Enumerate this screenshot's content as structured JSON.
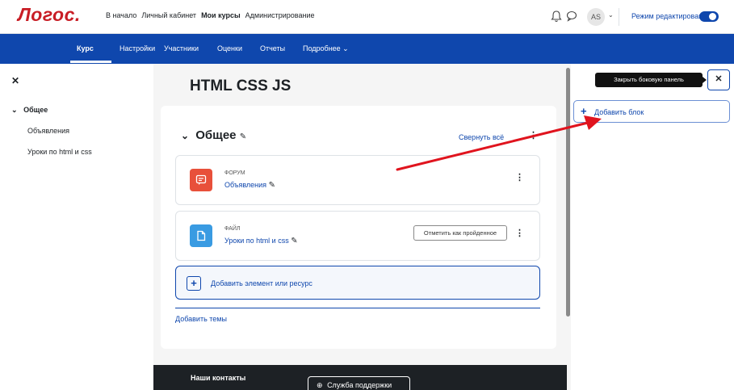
{
  "brand": {
    "logo": "Логос."
  },
  "topnav": {
    "items": [
      "В начало",
      "Личный кабинет",
      "Мои курсы",
      "Администрирование"
    ],
    "avatar_initials": "AS",
    "edit_mode_label": "Режим редактирования"
  },
  "course_nav": {
    "tabs": [
      "Курс",
      "Настройки",
      "Участники",
      "Оценки",
      "Отчеты",
      "Подробнее ⌄"
    ]
  },
  "left_drawer": {
    "section": "Общее",
    "items": [
      "Объявления",
      "Уроки по html и css"
    ]
  },
  "main": {
    "course_title": "HTML CSS JS",
    "section_title": "Общее",
    "collapse_all": "Свернуть всё",
    "activities": [
      {
        "type": "ФОРУМ",
        "name": "Объявления",
        "color": "#e8503a"
      },
      {
        "type": "ФАЙЛ",
        "name": "Уроки по html и css",
        "color": "#399be2",
        "complete_button": "Отметить как пройденное"
      }
    ],
    "add_element": "Добавить элемент или ресурс",
    "add_topics": "Добавить темы"
  },
  "footer": {
    "title": "Наши контакты",
    "support_button": "Служба поддержки"
  },
  "right_drawer": {
    "tooltip": "Закрыть боковую панель",
    "add_block": "Добавить блок"
  }
}
